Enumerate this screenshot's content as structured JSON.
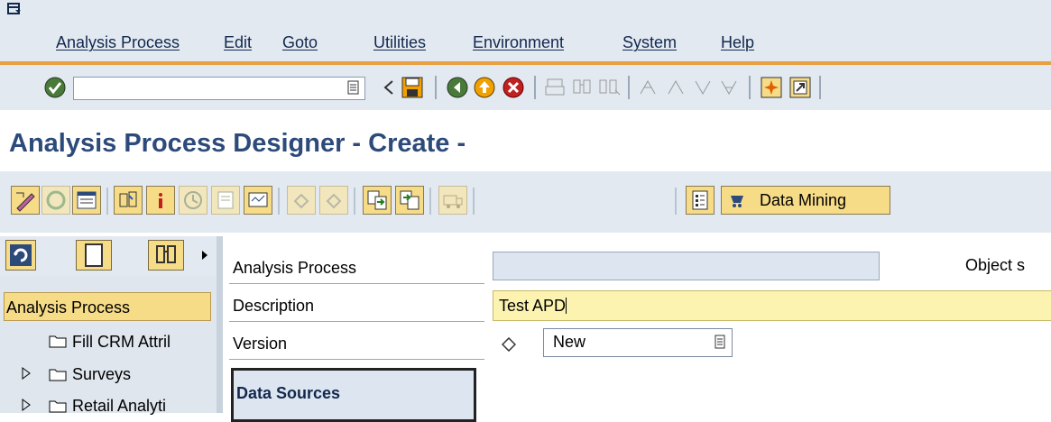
{
  "menu": {
    "items": [
      "Analysis Process",
      "Edit",
      "Goto",
      "Utilities",
      "Environment",
      "System",
      "Help"
    ]
  },
  "toolbar": {
    "command_field": "",
    "icons": [
      "enter-icon",
      "dropdown-icon",
      "back-arrow-icon",
      "save-icon",
      "back-icon",
      "exit-icon",
      "cancel-icon",
      "print-icon",
      "find-icon",
      "find-next-icon",
      "first-page-icon",
      "previous-page-icon",
      "next-page-icon",
      "last-page-icon",
      "create-session-icon",
      "shortcut-icon"
    ]
  },
  "title": {
    "text": "Analysis Process Designer - Create -"
  },
  "app_toolbar": {
    "icons": [
      "change-icon",
      "other-object-icon",
      "display-list-icon",
      "check-icon",
      "info-icon",
      "schedule-icon",
      "document-icon",
      "monitor-icon",
      "undo-icon",
      "redo-icon",
      "import-icon",
      "export-icon",
      "transport-icon",
      "structure-icon"
    ],
    "data_mining_label": "Data Mining"
  },
  "nav": {
    "toolbar_icons": [
      "refresh-icon",
      "new-document-icon",
      "search-icon",
      "expand-arrow-icon"
    ],
    "header": "Analysis Process",
    "tree": [
      {
        "label": "Fill CRM Attril",
        "expandable": false
      },
      {
        "label": "Surveys",
        "expandable": true
      },
      {
        "label": "Retail Analyti",
        "expandable": true
      }
    ]
  },
  "form": {
    "analysis_process_label": "Analysis Process",
    "analysis_process_value": "",
    "object_status_label": "Object s",
    "description_label": "Description",
    "description_value": "Test APD",
    "version_label": "Version",
    "version_value": "New",
    "data_sources_label": "Data Sources"
  },
  "colors": {
    "chrome": "#e2e9f1",
    "title_text": "#2c4a7a",
    "button_yellow": "#f7dc88",
    "accent_orange": "#e8a040",
    "required_field": "#fdf3b0"
  }
}
